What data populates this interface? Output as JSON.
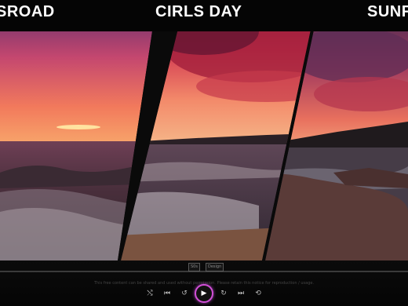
{
  "panels": [
    {
      "title": "SROAD",
      "icon": "sunset-sea-image"
    },
    {
      "title": "CIRLS DAY",
      "icon": "sunset-beach-image"
    },
    {
      "title": "SUNF",
      "icon": "rocky-shore-image"
    }
  ],
  "player": {
    "markers": [
      "S0s",
      "Design"
    ],
    "caption": "This free content can be shared and used without permission. Please retain this notice for reproduction / usage.",
    "controls": {
      "shuffle_icon": "shuffle-icon",
      "prev_icon": "skip-back-icon",
      "rewind_icon": "rewind-icon",
      "play_icon": "play-icon",
      "forward_icon": "forward-icon",
      "next_icon": "skip-forward-icon",
      "repeat_icon": "repeat-icon"
    }
  },
  "colors": {
    "accent": "#d14fd6"
  }
}
